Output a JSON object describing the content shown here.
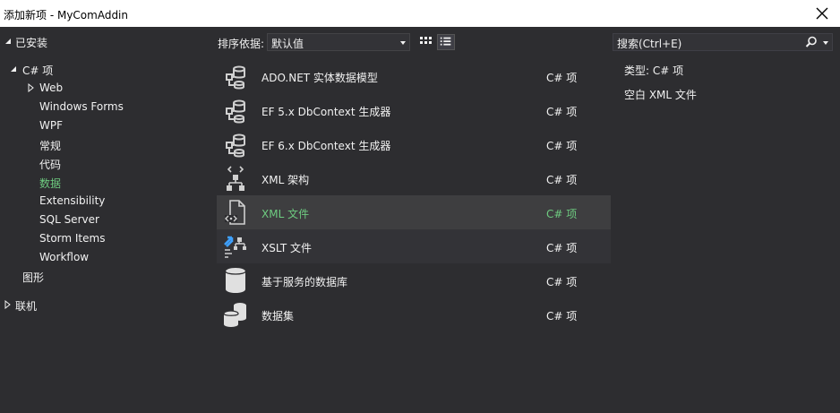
{
  "window": {
    "title": "添加新项 - MyComAddin"
  },
  "tree": {
    "installed": "已安装",
    "csharp": "C# 项",
    "children": [
      "Web",
      "Windows Forms",
      "WPF",
      "常规",
      "代码",
      "数据",
      "Extensibility",
      "SQL Server",
      "Storm Items",
      "Workflow"
    ],
    "graphics": "图形",
    "online": "联机"
  },
  "toolbar": {
    "sort_label": "排序依据:",
    "sort_value": "默认值"
  },
  "search": {
    "placeholder": "搜索(Ctrl+E)"
  },
  "templates": [
    {
      "name": "ADO.NET 实体数据模型",
      "lang": "C# 项",
      "icon": "entity-model-icon"
    },
    {
      "name": "EF 5.x DbContext 生成器",
      "lang": "C# 项",
      "icon": "entity-model-icon"
    },
    {
      "name": "EF 6.x DbContext 生成器",
      "lang": "C# 项",
      "icon": "entity-model-icon"
    },
    {
      "name": "XML 架构",
      "lang": "C# 项",
      "icon": "xml-schema-icon"
    },
    {
      "name": "XML 文件",
      "lang": "C# 项",
      "icon": "xml-file-icon"
    },
    {
      "name": "XSLT 文件",
      "lang": "C# 项",
      "icon": "xslt-file-icon"
    },
    {
      "name": "基于服务的数据库",
      "lang": "C# 项",
      "icon": "database-icon"
    },
    {
      "name": "数据集",
      "lang": "C# 项",
      "icon": "dataset-icon"
    }
  ],
  "details": {
    "type_line": "类型:  C# 项",
    "description": "空白 XML 文件"
  },
  "colors": {
    "background": "#2d2d30",
    "selected_text": "#6ecb80",
    "text": "#f1f1f1"
  }
}
